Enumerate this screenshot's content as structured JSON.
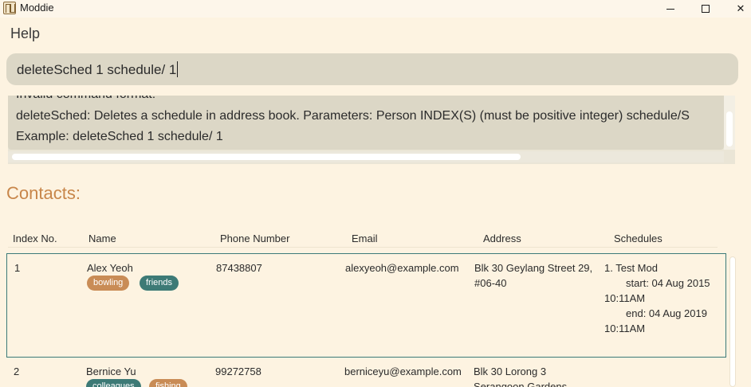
{
  "window": {
    "title": "Moddie",
    "minimize_icon": "minimize-icon",
    "maximize_icon": "maximize-icon",
    "close_glyph": "✕"
  },
  "menu": {
    "help": "Help"
  },
  "command": {
    "value": "deleteSched 1 schedule/ 1"
  },
  "result": {
    "lines": [
      "Invalid command format!",
      "deleteSched: Deletes a schedule in address book. Parameters: Person INDEX(S) (must be positive integer) schedule/S",
      "Example: deleteSched 1 schedule/ 1"
    ]
  },
  "contacts": {
    "title": "Contacts:",
    "headers": [
      "Index No.",
      "Name",
      "Phone Number",
      "Email",
      "Address",
      "Schedules"
    ],
    "rows": [
      {
        "index": "1",
        "name": "Alex Yeoh",
        "tags": [
          "bowling",
          "friends"
        ],
        "phone": "87438807",
        "email": "alexyeoh@example.com",
        "address_lines": [
          "Blk 30 Geylang Street 29,",
          "#06-40"
        ],
        "schedule_lines": [
          "1. Test Mod",
          "start: 04 Aug 2015",
          "10:11AM",
          "end: 04 Aug 2019",
          "10:11AM"
        ]
      },
      {
        "index": "2",
        "name": "Bernice Yu",
        "tags": [
          "colleagues",
          "fishing"
        ],
        "phone": "99272758",
        "email": "berniceyu@example.com",
        "address_lines": [
          "Blk 30 Lorong 3",
          "Serangoon Gardens,"
        ]
      }
    ]
  },
  "colors": {
    "background": "#fdf3e1",
    "accent": "#c8864a",
    "selected_border": "#3b7a78",
    "tag_orange": "#c98c56",
    "tag_teal": "#3d7a76"
  }
}
